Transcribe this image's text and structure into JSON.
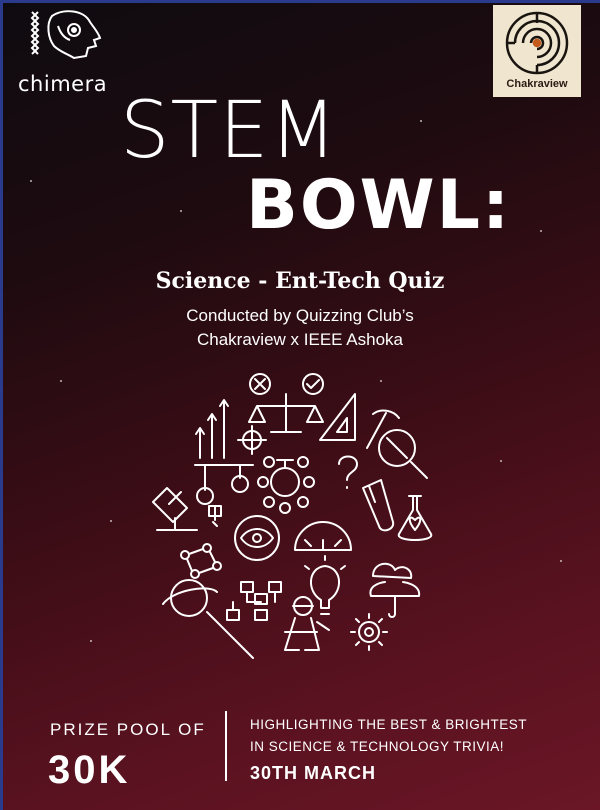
{
  "brand": {
    "left_logo_label": "chimera",
    "right_logo_label": "Chakraview"
  },
  "title": {
    "line1": "STEM",
    "line2": "BOWL:"
  },
  "subtitle": "Science - Ent-Tech Quiz",
  "conducted": {
    "line1": "Conducted by Quizzing Club’s",
    "line2": "Chakraview x IEEE Ashoka"
  },
  "prize": {
    "label": "PRIZE POOL OF",
    "value": "30K"
  },
  "highlight": {
    "line1": "HIGHLIGHTING THE BEST & BRIGHTEST",
    "line2": "IN SCIENCE & TECHNOLOGY TRIVIA!"
  },
  "date": "30TH MARCH",
  "colors": {
    "background_dark": "#0e0b10",
    "background_maroon": "#5a1220",
    "text": "#ffffff",
    "logo_box": "#f0e6d0"
  },
  "icons": [
    "balance-scale-icon",
    "bar-chart-icon",
    "set-square-icon",
    "target-icon",
    "pickaxe-icon",
    "magnifier-icon",
    "question-icon",
    "microscope-icon",
    "pulley-icon",
    "atom-checklist-icon",
    "test-tube-icon",
    "flask-plant-icon",
    "eye-icon",
    "protractor-icon",
    "network-icon",
    "planet-icon",
    "lightbulb-icon",
    "weather-icon",
    "flowchart-icon",
    "engineer-icon",
    "gear-icon",
    "syringe-icon"
  ]
}
